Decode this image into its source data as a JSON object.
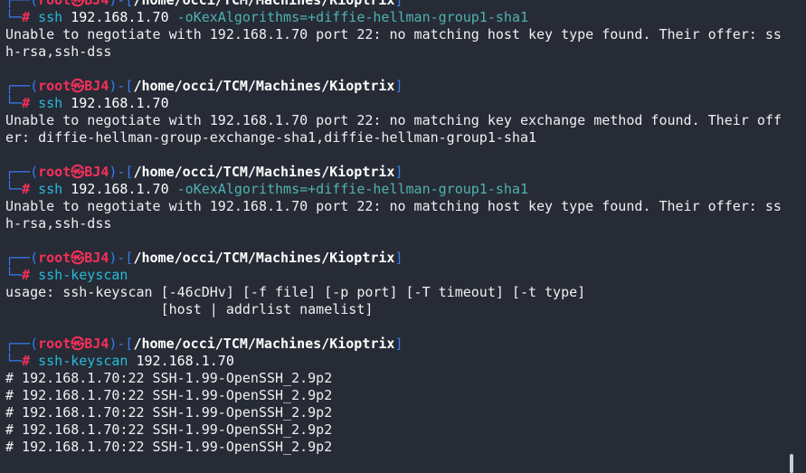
{
  "theme": {
    "background": "#272b36",
    "prompt_frame": "#367bf0",
    "user_color": "#f5305a",
    "command_color": "#26bbd9",
    "option_color": "#4fb3b0",
    "text_color": "#f0f0f0"
  },
  "prompt": {
    "top_prefix": "┌──(",
    "user": "root",
    "at_symbol": "㉿",
    "host": "BJ4",
    "mid": ")-[",
    "path": "/home/occi/TCM/Machines/Kioptrix",
    "close": "]",
    "bottom_prefix": "└─",
    "hash": "#"
  },
  "blocks": [
    {
      "command": "ssh",
      "args": " 192.168.1.70",
      "option": " -oKexAlgorithms=+diffie-hellman-group1-sha1",
      "output": [
        "Unable to negotiate with 192.168.1.70 port 22: no matching host key type found. Their offer: ss",
        "h-rsa,ssh-dss"
      ]
    },
    {
      "command": "ssh",
      "args": " 192.168.1.70",
      "option": "",
      "output": [
        "Unable to negotiate with 192.168.1.70 port 22: no matching key exchange method found. Their off",
        "er: diffie-hellman-group-exchange-sha1,diffie-hellman-group1-sha1"
      ]
    },
    {
      "command": "ssh",
      "args": " 192.168.1.70",
      "option": " -oKexAlgorithms=+diffie-hellman-group1-sha1",
      "output": [
        "Unable to negotiate with 192.168.1.70 port 22: no matching host key type found. Their offer: ss",
        "h-rsa,ssh-dss"
      ]
    },
    {
      "command": "ssh-keyscan",
      "args": "",
      "option": "",
      "output": [
        "usage: ssh-keyscan [-46cDHv] [-f file] [-p port] [-T timeout] [-t type]",
        "                   [host | addrlist namelist]"
      ]
    },
    {
      "command": "ssh-keyscan",
      "args": " 192.168.1.70",
      "option": "",
      "output": [
        "# 192.168.1.70:22 SSH-1.99-OpenSSH_2.9p2",
        "# 192.168.1.70:22 SSH-1.99-OpenSSH_2.9p2",
        "# 192.168.1.70:22 SSH-1.99-OpenSSH_2.9p2",
        "# 192.168.1.70:22 SSH-1.99-OpenSSH_2.9p2",
        "# 192.168.1.70:22 SSH-1.99-OpenSSH_2.9p2"
      ]
    }
  ]
}
